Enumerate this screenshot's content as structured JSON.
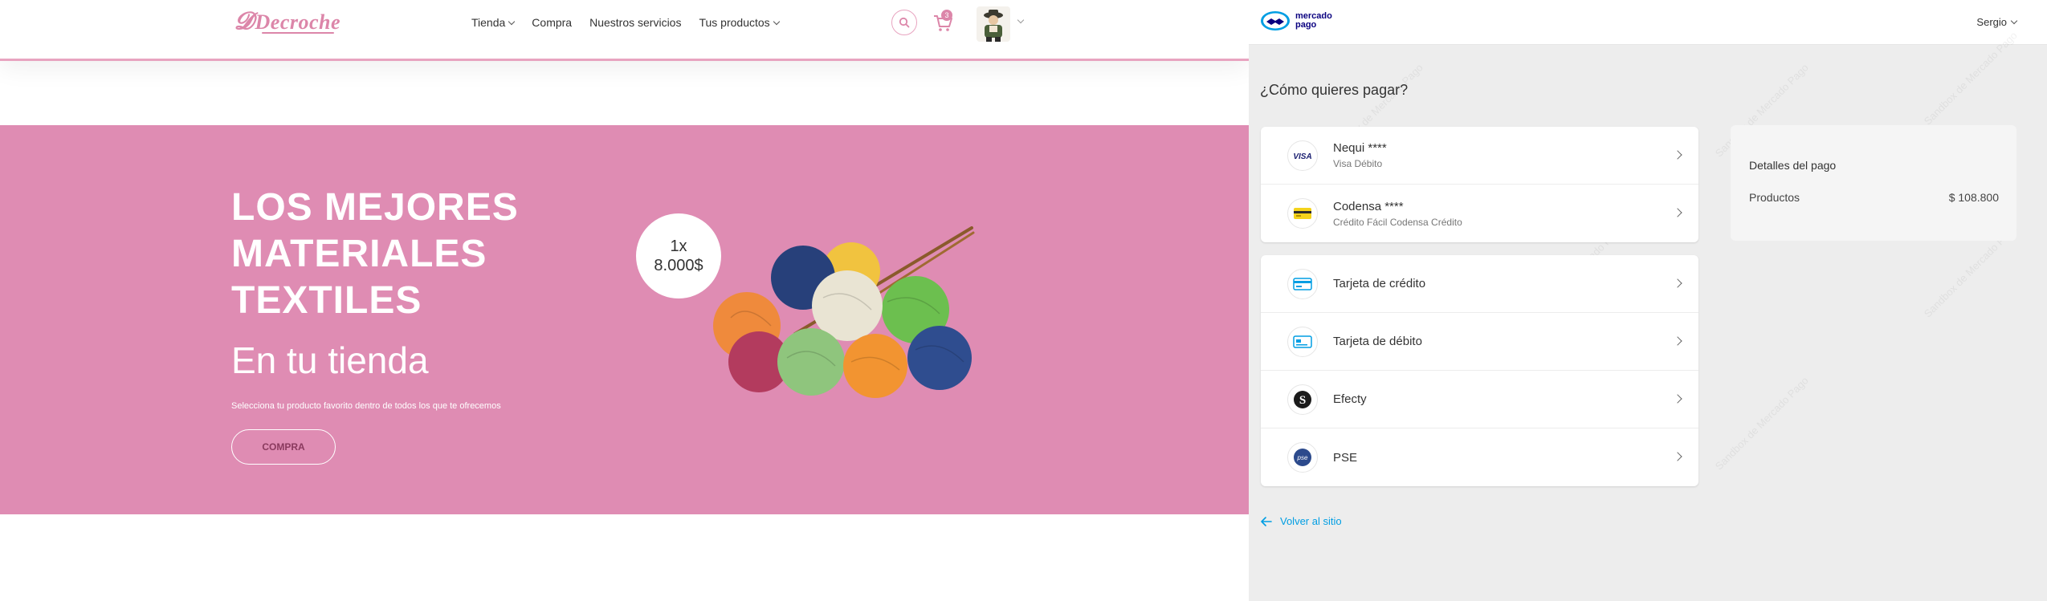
{
  "site": {
    "logo_text": "Decroche",
    "nav": [
      {
        "label": "Tienda",
        "dropdown": true
      },
      {
        "label": "Compra",
        "dropdown": false
      },
      {
        "label": "Nuestros servicios",
        "dropdown": false
      },
      {
        "label": "Tus productos",
        "dropdown": true
      }
    ],
    "cart_count": "3",
    "hero": {
      "title": "LOS MEJORES MATERIALES TEXTILES",
      "subtitle": "En tu tienda",
      "small_text": "Selecciona tu producto favorito dentro de todos los que te ofrecemos",
      "button_label": "COMPRA",
      "price_line1": "1x",
      "price_line2": "8.000$"
    },
    "colors": {
      "accent": "#df8cb3",
      "logo": "#dc86a9"
    }
  },
  "mp": {
    "brand_line1": "mercado",
    "brand_line2": "pago",
    "user_name": "Sergio",
    "question": "¿Cómo quieres pagar?",
    "saved_methods": [
      {
        "title": "Nequi ****",
        "subtitle": "Visa Débito",
        "icon": "visa-icon"
      },
      {
        "title": "Codensa ****",
        "subtitle": "Crédito Fácil Codensa Crédito",
        "icon": "codensa-card-icon"
      }
    ],
    "other_methods": [
      {
        "title": "Tarjeta de crédito",
        "icon": "credit-card-icon"
      },
      {
        "title": "Tarjeta de débito",
        "icon": "debit-card-icon"
      },
      {
        "title": "Efecty",
        "icon": "efecty-icon"
      },
      {
        "title": "PSE",
        "icon": "pse-icon"
      }
    ],
    "details": {
      "title": "Detalles del pago",
      "product_label": "Productos",
      "product_value": "$ 108.800"
    },
    "back_link": "Volver al sitio",
    "watermark": "Sandbox de Mercado Pago",
    "colors": {
      "link": "#009ee3",
      "background": "#ededed"
    }
  }
}
